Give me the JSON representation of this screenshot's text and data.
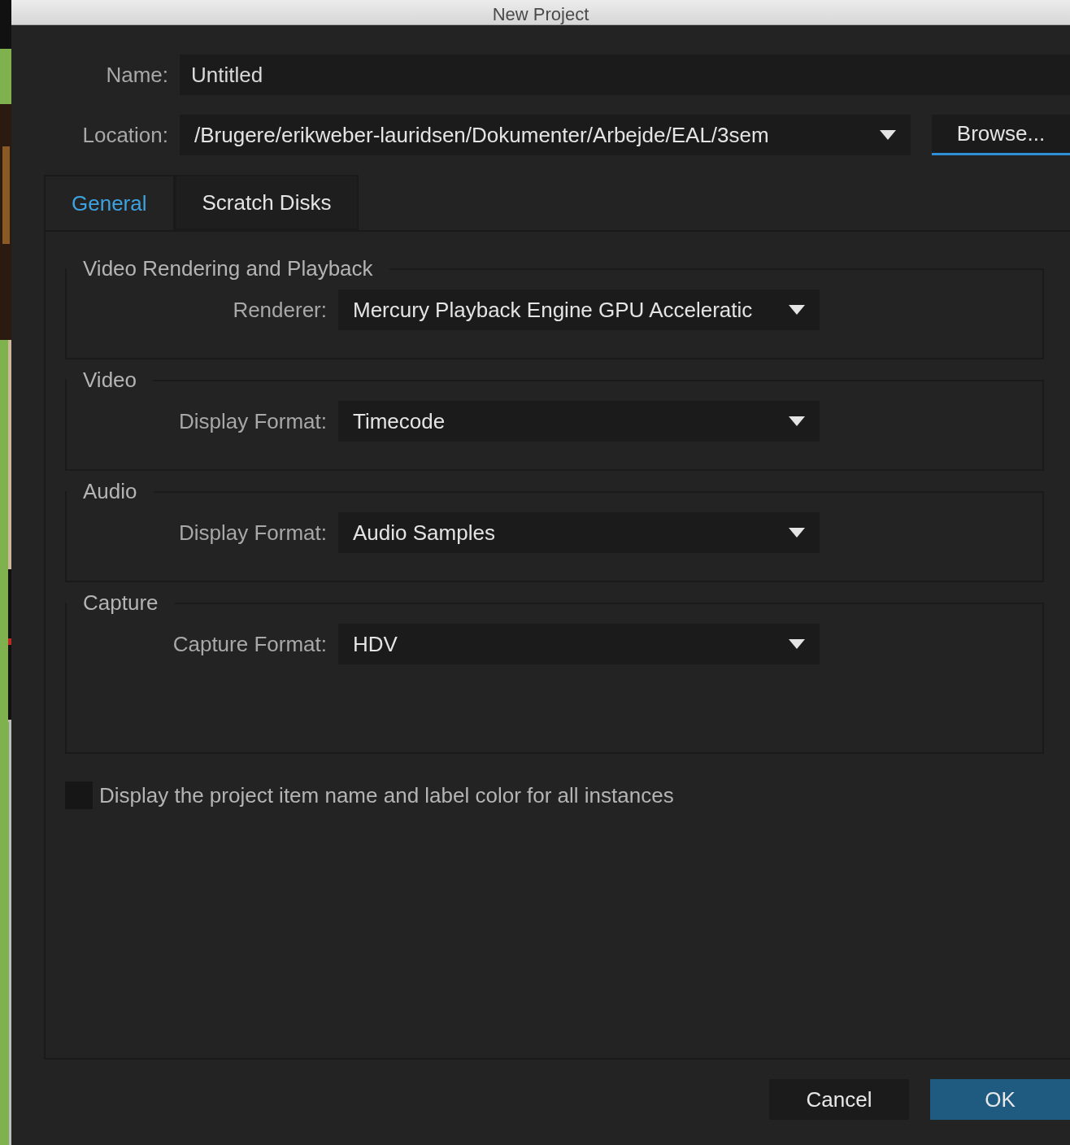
{
  "window": {
    "title": "New Project"
  },
  "name_field": {
    "label": "Name:",
    "value": "Untitled"
  },
  "location": {
    "label": "Location:",
    "value": "/Brugere/erikweber-lauridsen/Dokumenter/Arbejde/EAL/3sem",
    "button": "Browse..."
  },
  "tabs": [
    {
      "label": "General",
      "selected": true
    },
    {
      "label": "Scratch Disks",
      "selected": false
    }
  ],
  "sections": [
    {
      "title": "Video Rendering and Playback",
      "label": "Renderer:",
      "value": "Mercury Playback Engine GPU Acceleratic"
    },
    {
      "title": "Video",
      "label": "Display Format:",
      "value": "Timecode"
    },
    {
      "title": "Audio",
      "label": "Display Format:",
      "value": "Audio Samples"
    },
    {
      "title": "Capture",
      "label": "Capture Format:",
      "value": "HDV"
    }
  ],
  "checkbox": {
    "label": "Display the project item name and label color for all instances",
    "checked": false
  },
  "buttons": [
    {
      "label": "Cancel",
      "kind": "secondary"
    },
    {
      "label": "OK",
      "kind": "primary"
    }
  ]
}
